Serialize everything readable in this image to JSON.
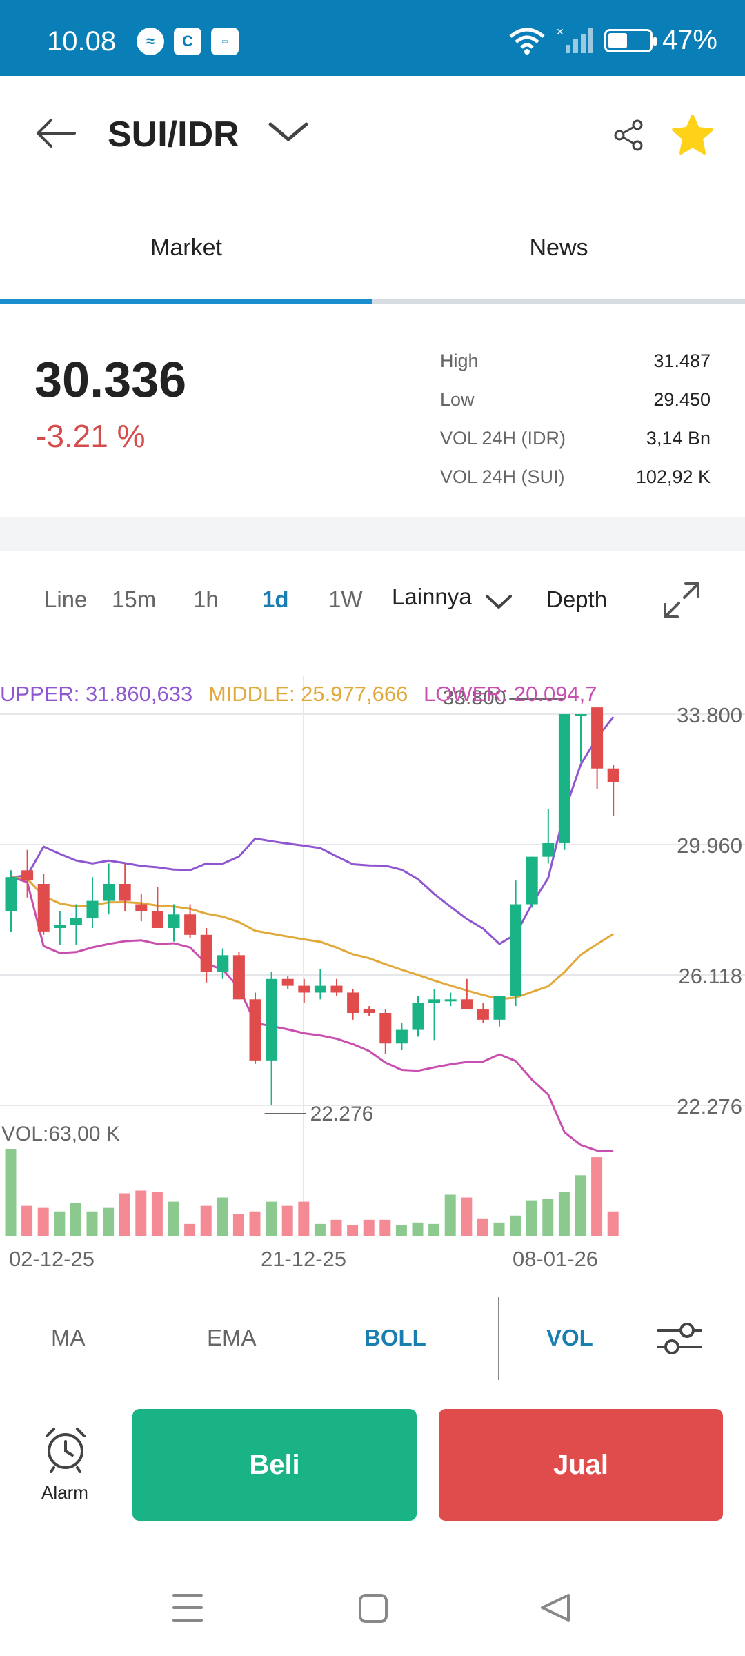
{
  "status": {
    "time": "10.08",
    "battery": "47%",
    "battery_level": 0.47
  },
  "header": {
    "pair": "SUI/IDR"
  },
  "tabs": [
    {
      "label": "Market",
      "active": true
    },
    {
      "label": "News",
      "active": false
    }
  ],
  "ticker": {
    "price": "30.336",
    "change": "-3.21 %",
    "stats": [
      {
        "label": "High",
        "value": "31.487"
      },
      {
        "label": "Low",
        "value": "29.450"
      },
      {
        "label": "VOL 24H (IDR)",
        "value": "3,14 Bn"
      },
      {
        "label": "VOL 24H (SUI)",
        "value": "102,92 K"
      }
    ]
  },
  "timeframes": {
    "line": "Line",
    "m15": "15m",
    "h1": "1h",
    "d1": "1d",
    "w1": "1W",
    "more": "Lainnya",
    "depth": "Depth"
  },
  "colors": {
    "up": "#1ab386",
    "down": "#e04b4b",
    "upper": "#8e57d1",
    "middle": "#e0a93a",
    "lower": "#c84fb0",
    "accent": "#1a7fb0"
  },
  "legend": {
    "upper": "UPPER: 31.860,633",
    "middle": "MIDDLE: 25.977,666",
    "lower": "LOWER: 20.094,7"
  },
  "chart_data": {
    "type": "candlestick",
    "y_axis_labels": [
      "33.800",
      "29.960",
      "26.118",
      "22.276"
    ],
    "ylim": [
      22276,
      33800
    ],
    "x_axis_labels": [
      "02-12-25",
      "21-12-25",
      "08-01-26"
    ],
    "max_marker": "33.800",
    "min_marker": "22.276",
    "volume_label": "VOL:63,00 K",
    "candles": [
      {
        "o": 28000,
        "h": 29200,
        "l": 27400,
        "c": 29000
      },
      {
        "o": 29200,
        "h": 29800,
        "l": 28400,
        "c": 28900
      },
      {
        "o": 28800,
        "h": 29100,
        "l": 27300,
        "c": 27400
      },
      {
        "o": 27500,
        "h": 28000,
        "l": 27000,
        "c": 27600
      },
      {
        "o": 27600,
        "h": 28200,
        "l": 27000,
        "c": 27800
      },
      {
        "o": 27800,
        "h": 29000,
        "l": 27500,
        "c": 28300
      },
      {
        "o": 28300,
        "h": 29400,
        "l": 27900,
        "c": 28800
      },
      {
        "o": 28800,
        "h": 29400,
        "l": 28000,
        "c": 28300
      },
      {
        "o": 28200,
        "h": 28500,
        "l": 27700,
        "c": 28000
      },
      {
        "o": 28000,
        "h": 28700,
        "l": 27500,
        "c": 27500
      },
      {
        "o": 27500,
        "h": 28200,
        "l": 27100,
        "c": 27900
      },
      {
        "o": 27900,
        "h": 28200,
        "l": 27200,
        "c": 27300
      },
      {
        "o": 27300,
        "h": 27500,
        "l": 25900,
        "c": 26200
      },
      {
        "o": 26200,
        "h": 26900,
        "l": 26000,
        "c": 26700
      },
      {
        "o": 26700,
        "h": 26800,
        "l": 25400,
        "c": 25400
      },
      {
        "o": 25400,
        "h": 25600,
        "l": 23500,
        "c": 23600
      },
      {
        "o": 23600,
        "h": 26200,
        "l": 22276,
        "c": 26000
      },
      {
        "o": 26000,
        "h": 26100,
        "l": 25700,
        "c": 25800
      },
      {
        "o": 25800,
        "h": 26000,
        "l": 25300,
        "c": 25600
      },
      {
        "o": 25600,
        "h": 26300,
        "l": 25400,
        "c": 25800
      },
      {
        "o": 25800,
        "h": 26000,
        "l": 25500,
        "c": 25600
      },
      {
        "o": 25600,
        "h": 25700,
        "l": 24800,
        "c": 25000
      },
      {
        "o": 25100,
        "h": 25200,
        "l": 24900,
        "c": 25000
      },
      {
        "o": 25000,
        "h": 25100,
        "l": 23800,
        "c": 24100
      },
      {
        "o": 24100,
        "h": 24700,
        "l": 23900,
        "c": 24500
      },
      {
        "o": 24500,
        "h": 25500,
        "l": 24300,
        "c": 25300
      },
      {
        "o": 25300,
        "h": 25700,
        "l": 24200,
        "c": 25400
      },
      {
        "o": 25400,
        "h": 25600,
        "l": 25200,
        "c": 25400
      },
      {
        "o": 25400,
        "h": 26000,
        "l": 25100,
        "c": 25100
      },
      {
        "o": 25100,
        "h": 25300,
        "l": 24700,
        "c": 24800
      },
      {
        "o": 24800,
        "h": 25500,
        "l": 24600,
        "c": 25500
      },
      {
        "o": 25500,
        "h": 28900,
        "l": 25200,
        "c": 28200
      },
      {
        "o": 28200,
        "h": 29600,
        "l": 28100,
        "c": 29600
      },
      {
        "o": 29600,
        "h": 31000,
        "l": 29400,
        "c": 30000
      },
      {
        "o": 30000,
        "h": 33800,
        "l": 29800,
        "c": 33800
      },
      {
        "o": 33800,
        "h": 33800,
        "l": 32400,
        "c": 33800
      },
      {
        "o": 34000,
        "h": 33600,
        "l": 31600,
        "c": 32200
      },
      {
        "o": 32200,
        "h": 32300,
        "l": 30800,
        "c": 31800
      }
    ],
    "volumes": [
      63,
      22,
      21,
      18,
      24,
      18,
      21,
      31,
      33,
      32,
      25,
      9,
      22,
      28,
      16,
      18,
      25,
      22,
      25,
      9,
      12,
      8,
      12,
      12,
      8,
      10,
      9,
      30,
      28,
      13,
      10,
      15,
      26,
      27,
      32,
      44,
      57,
      18
    ],
    "vol_max": 63
  },
  "indicators": {
    "ma": "MA",
    "ema": "EMA",
    "boll": "BOLL",
    "vol": "VOL"
  },
  "actions": {
    "alarm": "Alarm",
    "buy": "Beli",
    "sell": "Jual"
  }
}
